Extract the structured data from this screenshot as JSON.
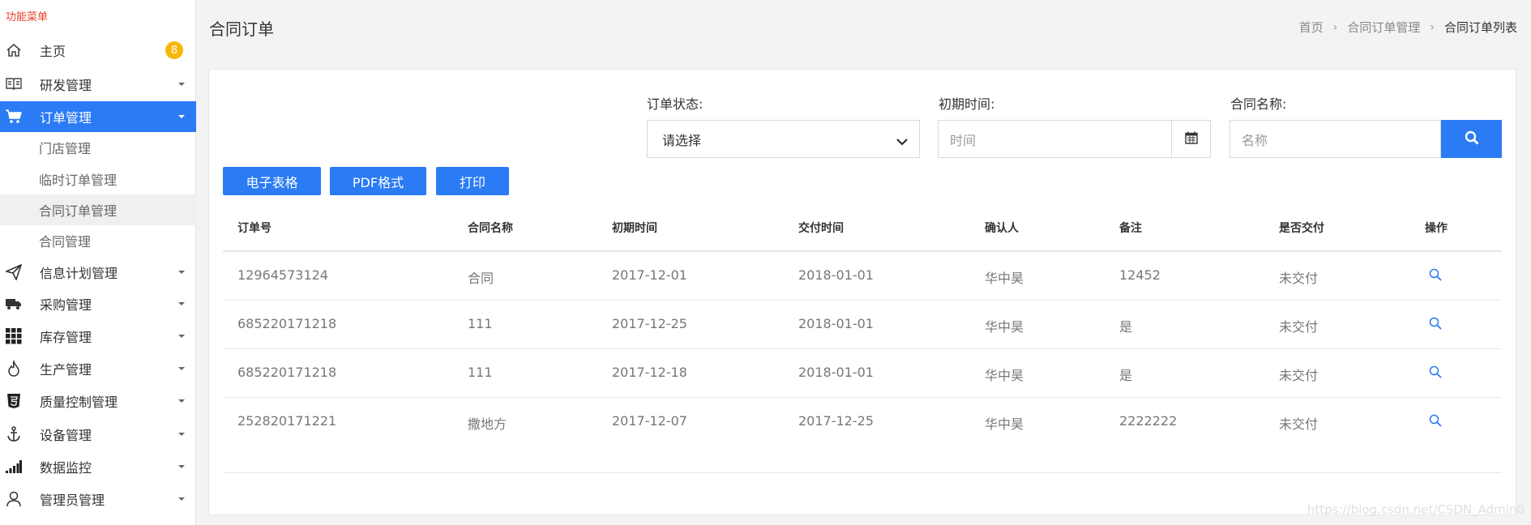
{
  "sidebar": {
    "title": "功能菜单",
    "home": {
      "label": "主页",
      "badge": "8"
    },
    "items": [
      {
        "label": "研发管理",
        "icon": "book-icon"
      },
      {
        "label": "订单管理",
        "icon": "cart-icon",
        "active": true
      },
      {
        "label": "信息计划管理",
        "icon": "paper-plane-icon"
      },
      {
        "label": "采购管理",
        "icon": "truck-icon"
      },
      {
        "label": "库存管理",
        "icon": "grid-icon"
      },
      {
        "label": "生产管理",
        "icon": "fire-icon"
      },
      {
        "label": "质量控制管理",
        "icon": "shield-icon"
      },
      {
        "label": "设备管理",
        "icon": "anchor-icon"
      },
      {
        "label": "数据监控",
        "icon": "signal-icon"
      },
      {
        "label": "管理员管理",
        "icon": "user-icon"
      }
    ],
    "sub_items": [
      "门店管理",
      "临时订单管理",
      "合同订单管理",
      "合同管理"
    ]
  },
  "header": {
    "title": "合同订单",
    "breadcrumb": [
      "首页",
      "合同订单管理",
      "合同订单列表"
    ]
  },
  "filters": {
    "status_label": "订单状态:",
    "status_value": "请选择",
    "date_label": "初期时间:",
    "date_placeholder": "时间",
    "name_label": "合同名称:",
    "name_placeholder": "名称"
  },
  "buttons": {
    "excel": "电子表格",
    "pdf": "PDF格式",
    "print": "打印"
  },
  "table": {
    "headers": [
      "订单号",
      "合同名称",
      "初期时间",
      "交付时间",
      "确认人",
      "备注",
      "是否交付",
      "操作"
    ],
    "rows": [
      [
        "12964573124",
        "合同",
        "2017-12-01",
        "2018-01-01",
        "华中昊",
        "12452",
        "未交付"
      ],
      [
        "685220171218",
        "111",
        "2017-12-25",
        "2018-01-01",
        "华中昊",
        "是",
        "未交付"
      ],
      [
        "685220171218",
        "111",
        "2017-12-18",
        "2018-01-01",
        "华中昊",
        "是",
        "未交付"
      ],
      [
        "252820171221",
        "撒地方",
        "2017-12-07",
        "2017-12-25",
        "华中昊",
        "2222222",
        "未交付"
      ]
    ]
  },
  "watermark": "https://blog.csdn.net/CSDN_Admin0",
  "colors": {
    "accent": "#2b7bf5",
    "badge": "#f7b80a",
    "menu_title": "#e8402b"
  }
}
